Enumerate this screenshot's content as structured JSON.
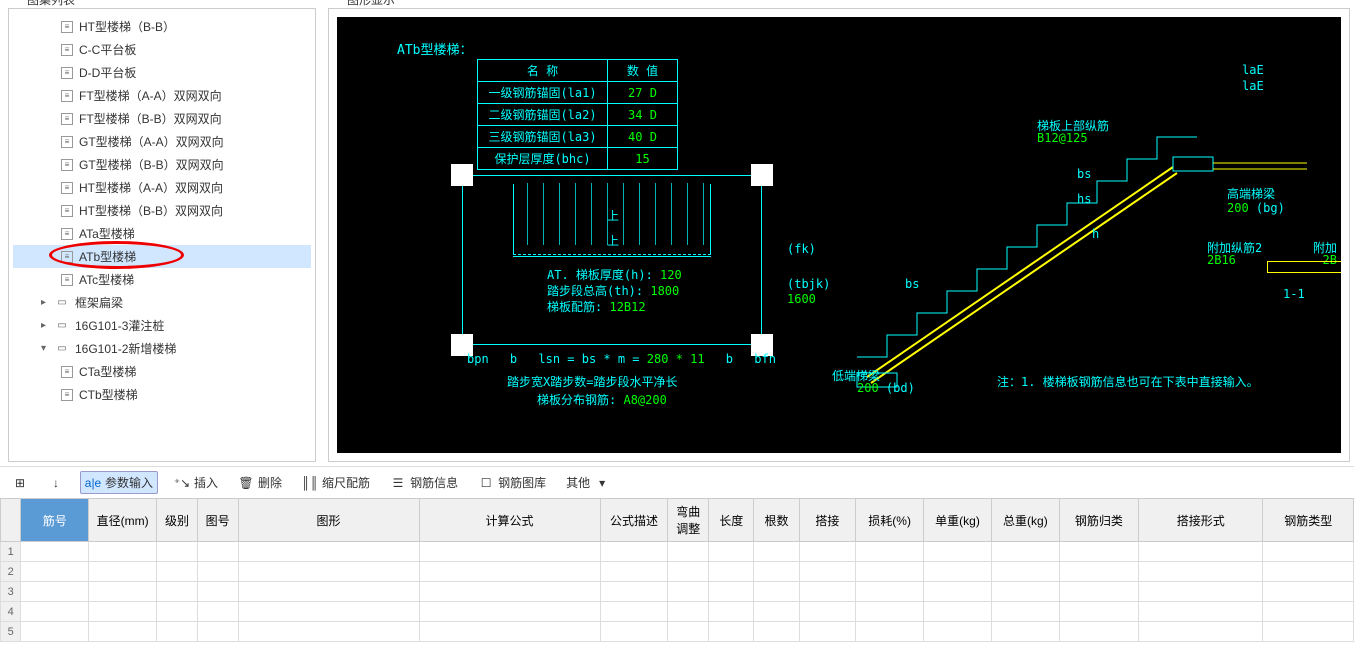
{
  "leftPanel": {
    "title": "图集列表"
  },
  "tree": {
    "items": [
      {
        "label": "HT型楼梯（B-B）",
        "type": "doc",
        "indent": 1
      },
      {
        "label": "C-C平台板",
        "type": "doc",
        "indent": 1
      },
      {
        "label": "D-D平台板",
        "type": "doc",
        "indent": 1
      },
      {
        "label": "FT型楼梯（A-A）双网双向",
        "type": "doc",
        "indent": 1
      },
      {
        "label": "FT型楼梯（B-B）双网双向",
        "type": "doc",
        "indent": 1
      },
      {
        "label": "GT型楼梯（A-A）双网双向",
        "type": "doc",
        "indent": 1
      },
      {
        "label": "GT型楼梯（B-B）双网双向",
        "type": "doc",
        "indent": 1
      },
      {
        "label": "HT型楼梯（A-A）双网双向",
        "type": "doc",
        "indent": 1
      },
      {
        "label": "HT型楼梯（B-B）双网双向",
        "type": "doc",
        "indent": 1
      },
      {
        "label": "ATa型楼梯",
        "type": "doc",
        "indent": 1
      },
      {
        "label": "ATb型楼梯",
        "type": "doc",
        "indent": 1,
        "selected": true,
        "highlight": true
      },
      {
        "label": "ATc型楼梯",
        "type": "doc",
        "indent": 1
      },
      {
        "label": "框架扁梁",
        "type": "folder",
        "indent": 0,
        "caret": "▸"
      },
      {
        "label": "16G101-3灌注桩",
        "type": "folder",
        "indent": 0,
        "caret": "▸"
      },
      {
        "label": "16G101-2新增楼梯",
        "type": "folder",
        "indent": 0,
        "caret": "▾"
      },
      {
        "label": "CTa型楼梯",
        "type": "doc",
        "indent": 1
      },
      {
        "label": "CTb型楼梯",
        "type": "doc",
        "indent": 1
      }
    ]
  },
  "rightPanel": {
    "title": "图形显示"
  },
  "diagram": {
    "title": "ATb型楼梯：",
    "paramHeader": {
      "name": "名 称",
      "value": "数 值"
    },
    "params": [
      {
        "name": "一级钢筋锚固(la1)",
        "value": "27 D"
      },
      {
        "name": "二级钢筋锚固(la2)",
        "value": "34 D"
      },
      {
        "name": "三级钢筋锚固(la3)",
        "value": "40 D"
      },
      {
        "name": "保护层厚度(bhc)",
        "value": "15"
      }
    ],
    "planLabels": {
      "thickness": "AT. 梯板厚度(h):",
      "thicknessVal": "120",
      "stepHeight": "踏步段总高(th):",
      "stepHeightVal": "1800",
      "rebar": "梯板配筋:",
      "rebarVal": "12B12",
      "fk": "(fk)",
      "tbjk": "(tbjk)",
      "tbjkVal": "1600",
      "bpn": "bpn",
      "b1": "b",
      "lsn": "lsn = bs * m = ",
      "lsnVal": "280 * 11",
      "b2": "b",
      "bfn": "bfn",
      "formula": "踏步宽X踏步数=踏步段水平净长",
      "distrib": "梯板分布钢筋:",
      "distribVal": "A8@200",
      "up": "上"
    },
    "section": {
      "topLabel": "梯板上部纵筋",
      "topVal": "B12@125",
      "highBeam": "高端梯梁",
      "bg": "(bg)",
      "bgVal": "200",
      "bs": "bs",
      "hs": "hs",
      "h": "h",
      "laE1": "laE",
      "laE2": "laE",
      "lowBeam": "低端梯梁",
      "bd": "(bd)",
      "bdVal": "200",
      "extra": "附加纵筋2",
      "extraVal": "2B16",
      "extraRight": "附加",
      "extraRightVal": "2B",
      "sectMark": "1-1",
      "note": "注：1. 楼梯板钢筋信息也可在下表中直接输入。"
    }
  },
  "toolbar": {
    "paramInput": "参数输入",
    "insert": "插入",
    "delete": "删除",
    "scaleRebar": "缩尺配筋",
    "rebarInfo": "钢筋信息",
    "rebarLib": "钢筋图库",
    "other": "其他"
  },
  "grid": {
    "headers": [
      "筋号",
      "直径(mm)",
      "级别",
      "图号",
      "图形",
      "计算公式",
      "公式描述",
      "弯曲调整",
      "长度",
      "根数",
      "搭接",
      "损耗(%)",
      "单重(kg)",
      "总重(kg)",
      "钢筋归类",
      "搭接形式",
      "钢筋类型"
    ],
    "rows": 5
  }
}
